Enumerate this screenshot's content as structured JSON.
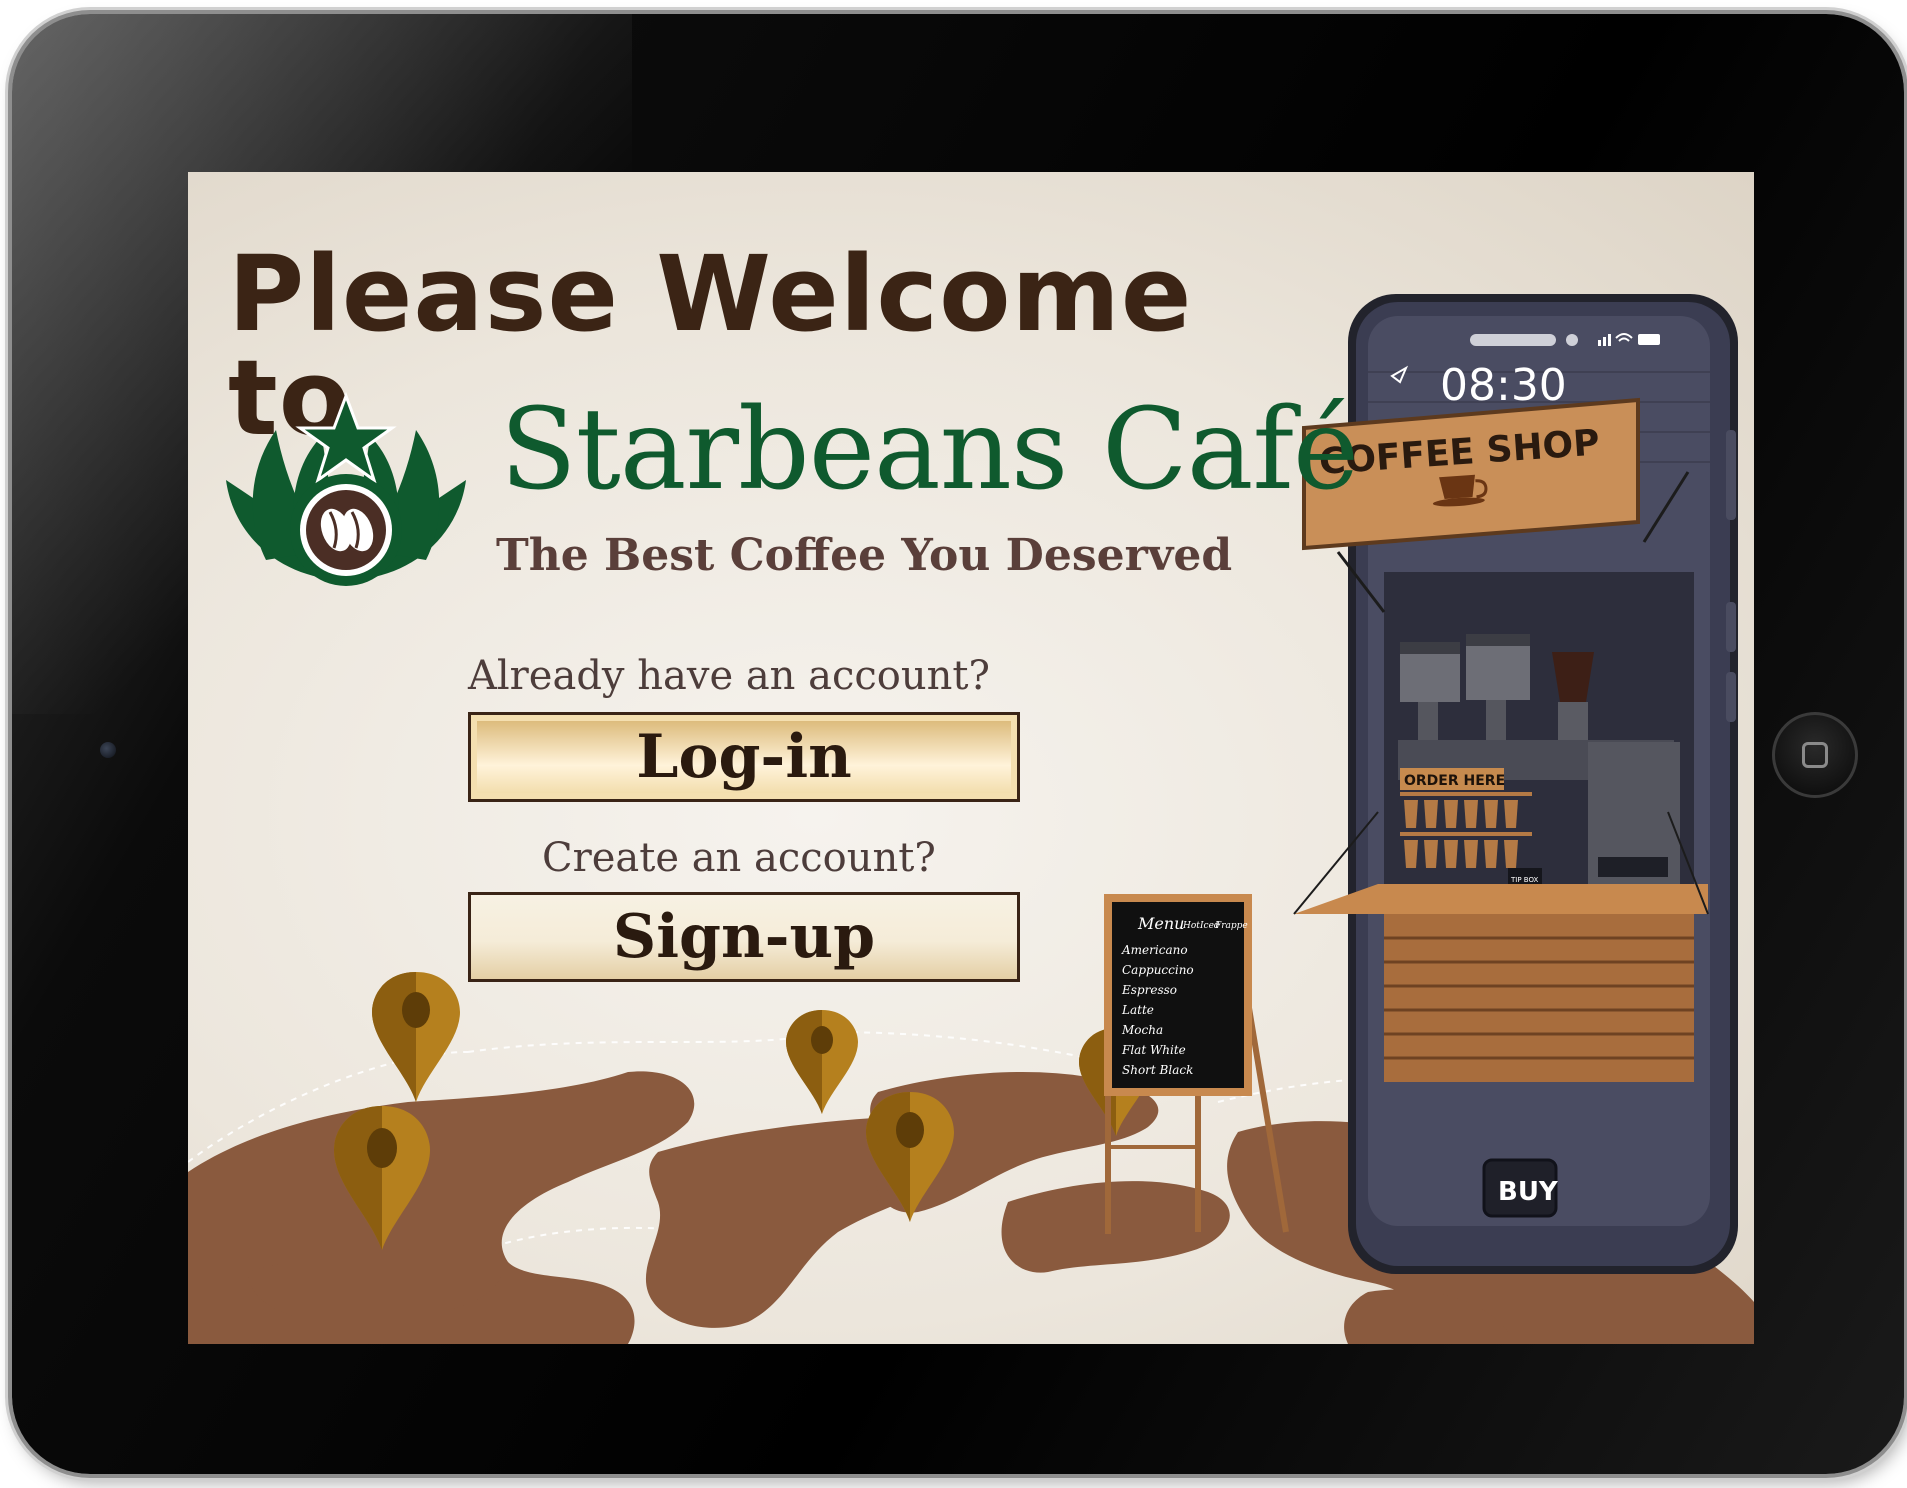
{
  "welcome": {
    "title": "Please Welcome to",
    "brand": "Starbeans Café",
    "tagline": "The Best Coffee You Deserved"
  },
  "login": {
    "prompt": "Already have an account?",
    "button_label": "Log-in"
  },
  "signup": {
    "prompt": "Create an account?",
    "button_label": "Sign-up"
  },
  "phone": {
    "time": "08:30",
    "buy_label": "BUY"
  },
  "shop": {
    "sign": "COFFEE SHOP",
    "order_sign": "ORDER HERE",
    "tip_box": "TIP BOX"
  },
  "menu_board": {
    "title": "Menu",
    "columns": [
      "Hot",
      "Iced",
      "Frappe"
    ],
    "items": [
      "Americano",
      "Cappuccino",
      "Espresso",
      "Latte",
      "Mocha",
      "Flat White",
      "Short Black"
    ]
  },
  "colors": {
    "brand_green": "#0f5a2e",
    "title_brown": "#3b2415",
    "map_brown": "#8a5a3e",
    "pin_gold": "#b5801e"
  }
}
